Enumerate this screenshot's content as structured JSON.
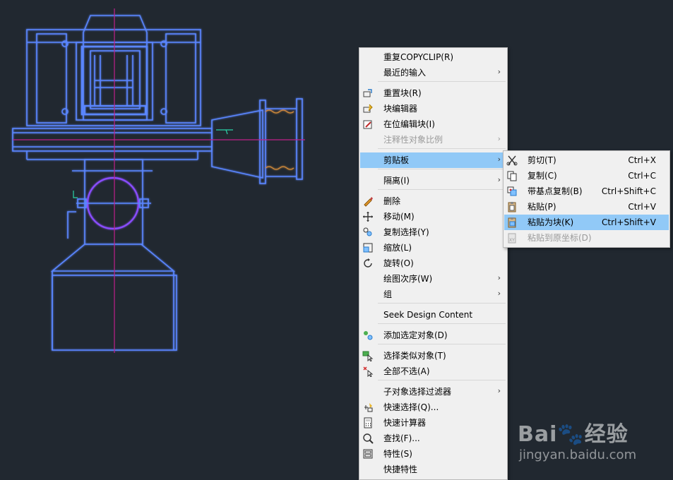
{
  "main_menu": {
    "items": [
      {
        "label": "重复COPYCLIP(R)",
        "icon": "",
        "arrow": false,
        "disabled": false
      },
      {
        "label": "最近的输入",
        "icon": "",
        "arrow": true,
        "disabled": false
      },
      {
        "label": "重置块(R)",
        "icon": "reset-block-icon",
        "arrow": false,
        "disabled": false
      },
      {
        "label": "块编辑器",
        "icon": "block-editor-icon",
        "arrow": false,
        "disabled": false
      },
      {
        "label": "在位编辑块(I)",
        "icon": "edit-in-place-icon",
        "arrow": false,
        "disabled": false
      },
      {
        "label": "注释性对象比例",
        "icon": "",
        "arrow": true,
        "disabled": true
      },
      {
        "label": "剪贴板",
        "icon": "",
        "arrow": true,
        "disabled": false,
        "highlight": true
      },
      {
        "label": "隔离(I)",
        "icon": "",
        "arrow": true,
        "disabled": false
      },
      {
        "label": "删除",
        "icon": "erase-icon",
        "arrow": false,
        "disabled": false
      },
      {
        "label": "移动(M)",
        "icon": "move-icon",
        "arrow": false,
        "disabled": false
      },
      {
        "label": "复制选择(Y)",
        "icon": "copy-selection-icon",
        "arrow": false,
        "disabled": false
      },
      {
        "label": "缩放(L)",
        "icon": "scale-icon",
        "arrow": false,
        "disabled": false
      },
      {
        "label": "旋转(O)",
        "icon": "rotate-icon",
        "arrow": false,
        "disabled": false
      },
      {
        "label": "绘图次序(W)",
        "icon": "",
        "arrow": true,
        "disabled": false
      },
      {
        "label": "组",
        "icon": "",
        "arrow": true,
        "disabled": false
      },
      {
        "label": "Seek Design Content",
        "icon": "",
        "arrow": false,
        "disabled": false
      },
      {
        "label": "添加选定对象(D)",
        "icon": "add-selected-icon",
        "arrow": false,
        "disabled": false
      },
      {
        "label": "选择类似对象(T)",
        "icon": "select-similar-icon",
        "arrow": false,
        "disabled": false
      },
      {
        "label": "全部不选(A)",
        "icon": "deselect-all-icon",
        "arrow": false,
        "disabled": false
      },
      {
        "label": "子对象选择过滤器",
        "icon": "",
        "arrow": true,
        "disabled": false
      },
      {
        "label": "快速选择(Q)...",
        "icon": "quick-select-icon",
        "arrow": false,
        "disabled": false
      },
      {
        "label": "快速计算器",
        "icon": "calculator-icon",
        "arrow": false,
        "disabled": false
      },
      {
        "label": "查找(F)...",
        "icon": "find-icon",
        "arrow": false,
        "disabled": false
      },
      {
        "label": "特性(S)",
        "icon": "properties-icon",
        "arrow": false,
        "disabled": false
      },
      {
        "label": "快捷特性",
        "icon": "",
        "arrow": false,
        "disabled": false
      }
    ]
  },
  "clipboard_menu": {
    "items": [
      {
        "label": "剪切(T)",
        "shortcut": "Ctrl+X",
        "icon": "scissors-icon",
        "disabled": false
      },
      {
        "label": "复制(C)",
        "shortcut": "Ctrl+C",
        "icon": "copy-icon",
        "disabled": false
      },
      {
        "label": "带基点复制(B)",
        "shortcut": "Ctrl+Shift+C",
        "icon": "copy-base-point-icon",
        "disabled": false
      },
      {
        "label": "粘贴(P)",
        "shortcut": "Ctrl+V",
        "icon": "paste-icon",
        "disabled": false
      },
      {
        "label": "粘贴为块(K)",
        "shortcut": "Ctrl+Shift+V",
        "icon": "paste-as-block-icon",
        "disabled": false,
        "highlight": true
      },
      {
        "label": "粘贴到原坐标(D)",
        "shortcut": "",
        "icon": "paste-original-coords-icon",
        "disabled": true
      }
    ]
  },
  "watermark": {
    "logo": "Bai🐾经验",
    "url": "jingyan.baidu.com"
  },
  "colors": {
    "background": "#212830",
    "drawing_line": "#4e7bff",
    "centerline": "#c0208a",
    "highlight": "#91c9f7"
  }
}
